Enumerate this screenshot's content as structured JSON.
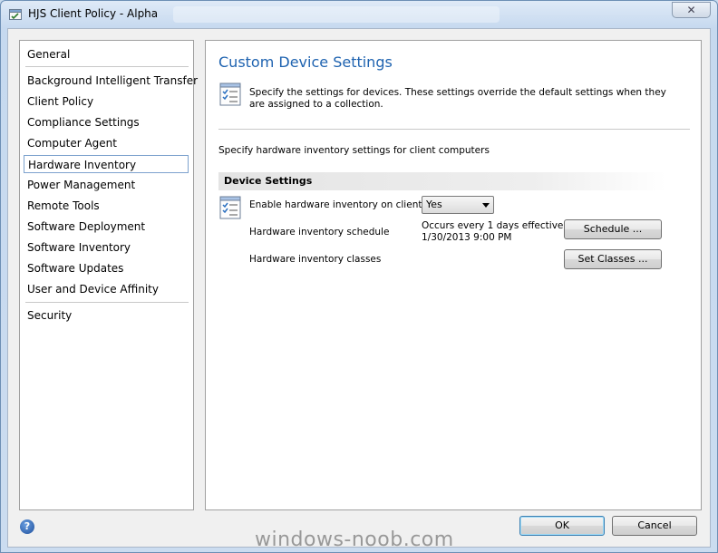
{
  "window": {
    "title": "HJS Client Policy - Alpha",
    "close_label": "✕"
  },
  "nav": {
    "items": [
      {
        "label": "General"
      },
      {
        "label": "Background Intelligent Transfer"
      },
      {
        "label": "Client Policy"
      },
      {
        "label": "Compliance Settings"
      },
      {
        "label": "Computer Agent"
      },
      {
        "label": "Hardware Inventory",
        "selected": true
      },
      {
        "label": "Power Management"
      },
      {
        "label": "Remote Tools"
      },
      {
        "label": "Software Deployment"
      },
      {
        "label": "Software Inventory"
      },
      {
        "label": "Software Updates"
      },
      {
        "label": "User and Device Affinity"
      },
      {
        "label": "Security"
      }
    ]
  },
  "main": {
    "title": "Custom Device Settings",
    "description": "Specify the settings for devices. These settings override the default settings when they are assigned to a collection.",
    "subdescription": "Specify hardware inventory settings for client computers",
    "section_title": "Device Settings",
    "settings": {
      "enable_label": "Enable hardware inventory on clients",
      "enable_value": "Yes",
      "schedule_label": "Hardware inventory schedule",
      "schedule_value_line1": "Occurs every 1 days effective",
      "schedule_value_line2": "1/30/2013 9:00 PM",
      "schedule_button": "Schedule ...",
      "classes_label": "Hardware inventory classes",
      "classes_button": "Set Classes ..."
    }
  },
  "footer": {
    "ok_label": "OK",
    "cancel_label": "Cancel",
    "help_glyph": "?"
  },
  "watermark": "windows-noob.com",
  "colors": {
    "title_blue": "#1f63b0",
    "selection_border": "#7da2ce"
  },
  "icons": [
    "policy-window-icon",
    "settings-doc-icon",
    "help-icon"
  ]
}
